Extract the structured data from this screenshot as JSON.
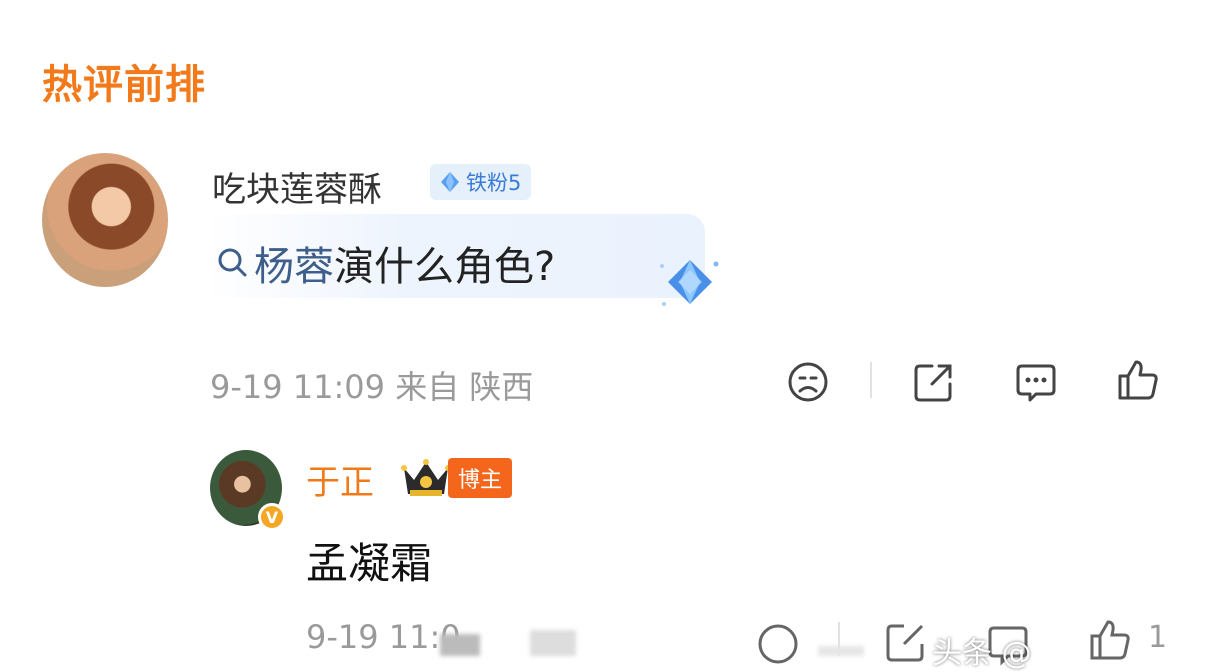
{
  "section_title": "热评前排",
  "comment": {
    "username": "吃块莲蓉酥",
    "fan_badge": "铁粉5",
    "search_link": "杨蓉",
    "text": "演什么角色?",
    "meta": "9-19 11:09 来自 陕西"
  },
  "reply": {
    "username": "于正",
    "tag": "博主",
    "text": "孟凝霜",
    "meta": "9-19 11:0",
    "like_count": "1"
  },
  "watermark": "头条 @",
  "colors": {
    "accent_orange": "#f27a1a",
    "link_blue": "#3d5f8a",
    "meta_gray": "#9a9a9a"
  },
  "icons": [
    "sad-face-icon",
    "share-icon",
    "comment-icon",
    "like-icon"
  ]
}
